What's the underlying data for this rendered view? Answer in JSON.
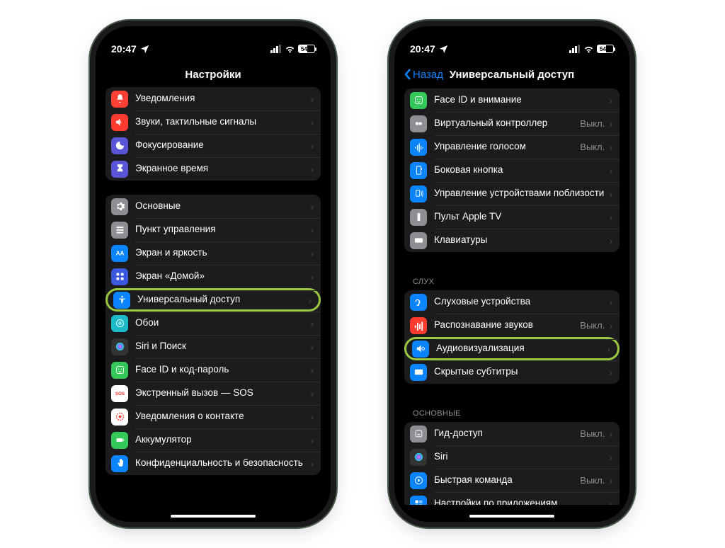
{
  "statusbar": {
    "time": "20:47",
    "battery": "54"
  },
  "left": {
    "title": "Настройки",
    "g1": [
      {
        "label": "Уведомления",
        "color": "#ff4035",
        "icon": "bell"
      },
      {
        "label": "Звуки, тактильные сигналы",
        "color": "#ff3b30",
        "icon": "speaker"
      },
      {
        "label": "Фокусирование",
        "color": "#5856d6",
        "icon": "moon"
      },
      {
        "label": "Экранное время",
        "color": "#5856d6",
        "icon": "hourglass"
      }
    ],
    "g2": [
      {
        "label": "Основные",
        "color": "#8e8e93",
        "icon": "gear"
      },
      {
        "label": "Пункт управления",
        "color": "#8e8e93",
        "icon": "controls"
      },
      {
        "label": "Экран и яркость",
        "color": "#0a84ff",
        "icon": "aa"
      },
      {
        "label": "Экран «Домой»",
        "color": "#3a58e0",
        "icon": "grid"
      },
      {
        "label": "Универсальный доступ",
        "color": "#0a84ff",
        "icon": "access",
        "hl": true
      },
      {
        "label": "Обои",
        "color": "#1ab9c7",
        "icon": "wall"
      },
      {
        "label": "Siri и Поиск",
        "color": "#333",
        "icon": "siri"
      },
      {
        "label": "Face ID и код-пароль",
        "color": "#34c759",
        "icon": "face"
      },
      {
        "label": "Экстренный вызов — SOS",
        "color": "#fff",
        "icon": "sos"
      },
      {
        "label": "Уведомления о контакте",
        "color": "#fff",
        "icon": "exposure"
      },
      {
        "label": "Аккумулятор",
        "color": "#34c759",
        "icon": "battery"
      },
      {
        "label": "Конфиденциальность и безопасность",
        "color": "#0a84ff",
        "icon": "hand"
      }
    ]
  },
  "right": {
    "back": "Назад",
    "title": "Универсальный доступ",
    "g1": [
      {
        "label": "Face ID и внимание",
        "color": "#34c759",
        "icon": "face"
      },
      {
        "label": "Виртуальный контроллер",
        "color": "#8e8e93",
        "icon": "switch",
        "value": "Выкл."
      },
      {
        "label": "Управление голосом",
        "color": "#0a84ff",
        "icon": "voice",
        "value": "Выкл."
      },
      {
        "label": "Боковая кнопка",
        "color": "#0a84ff",
        "icon": "side"
      },
      {
        "label": "Управление устройствами поблизости",
        "color": "#0a84ff",
        "icon": "nearby"
      },
      {
        "label": "Пульт Apple TV",
        "color": "#8e8e93",
        "icon": "remote"
      },
      {
        "label": "Клавиатуры",
        "color": "#8e8e93",
        "icon": "keyboard"
      }
    ],
    "sect2": "СЛУХ",
    "g2": [
      {
        "label": "Слуховые устройства",
        "color": "#0a84ff",
        "icon": "ear"
      },
      {
        "label": "Распознавание звуков",
        "color": "#ff3b30",
        "icon": "sound",
        "value": "Выкл."
      },
      {
        "label": "Аудиовизуализация",
        "color": "#0a84ff",
        "icon": "av",
        "hl": true
      },
      {
        "label": "Скрытые субтитры",
        "color": "#0a84ff",
        "icon": "cc"
      }
    ],
    "sect3": "ОСНОВНЫЕ",
    "g3": [
      {
        "label": "Гид-доступ",
        "color": "#8e8e93",
        "icon": "guided",
        "value": "Выкл."
      },
      {
        "label": "Siri",
        "color": "#333",
        "icon": "siri"
      },
      {
        "label": "Быстрая команда",
        "color": "#0a84ff",
        "icon": "shortcut",
        "value": "Выкл."
      },
      {
        "label": "Настройки по приложениям",
        "color": "#0a84ff",
        "icon": "perapp"
      }
    ]
  }
}
